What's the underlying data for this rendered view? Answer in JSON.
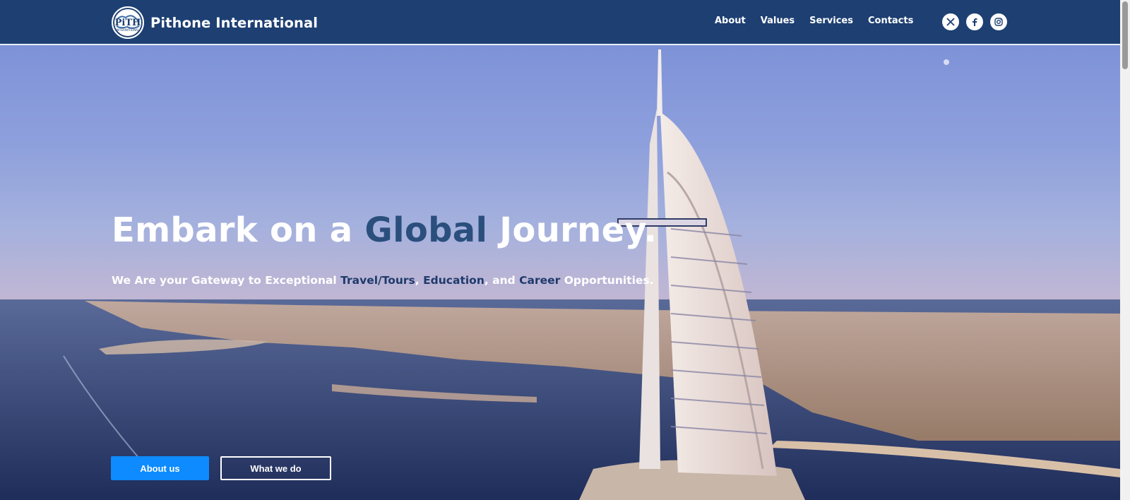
{
  "brand": {
    "name": "Pithone International",
    "logo_text": "PiTH",
    "logo_subtext": "INTERNATIONAL"
  },
  "nav": {
    "items": [
      "About",
      "Values",
      "Services",
      "Contacts"
    ]
  },
  "socials": [
    "x-icon",
    "facebook-icon",
    "instagram-icon"
  ],
  "hero": {
    "title_part1": "Embark on a ",
    "title_highlight": "Global",
    "title_part2": " Journey.",
    "subtitle_part1": "We Are your Gateway to Exceptional ",
    "subtitle_hl1": "Travel/Tours",
    "subtitle_sep1": ", ",
    "subtitle_hl2": "Education",
    "subtitle_sep2": ", and ",
    "subtitle_hl3": "Career",
    "subtitle_part2": " Opportunities.",
    "primary_button": "About us",
    "secondary_button": "What we do"
  },
  "colors": {
    "header_bg": "#1d3f72",
    "primary_button": "#0d8bff",
    "highlight": "#2a4f7d"
  }
}
